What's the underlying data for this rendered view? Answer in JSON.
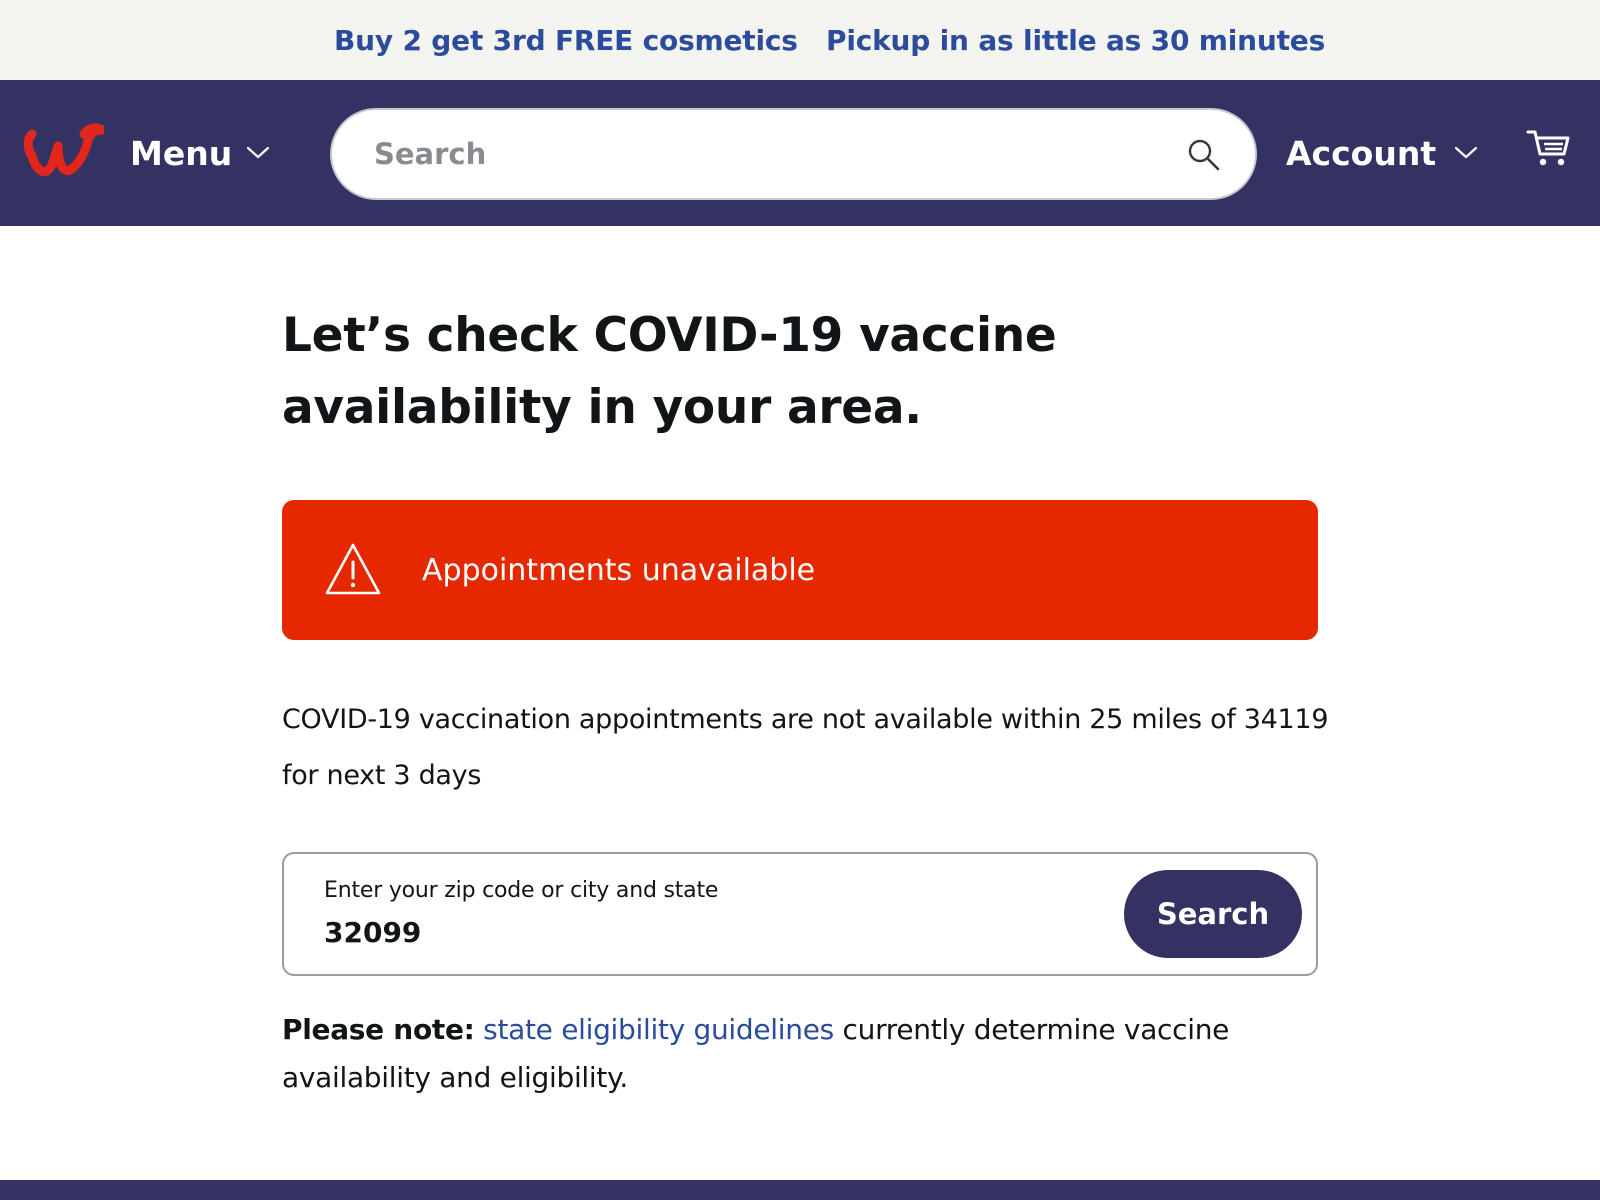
{
  "promo": {
    "left": "Buy 2 get 3rd FREE cosmetics",
    "right": "Pickup in as little as 30 minutes"
  },
  "nav": {
    "menu_label": "Menu",
    "search_placeholder": "Search",
    "account_label": "Account"
  },
  "main": {
    "title": "Let’s check COVID-19 vaccine availability in your area.",
    "alert_text": "Appointments unavailable",
    "message": "COVID-19 vaccination appointments are not available within 25 miles of 34119 for next 3 days",
    "zip_label": "Enter your zip code or city and state",
    "zip_value": "32099",
    "search_button": "Search",
    "note_bold": "Please note:",
    "note_link": "state eligibility guidelines",
    "note_rest": " currently determine vaccine availability and eligibility."
  },
  "colors": {
    "brand_navy": "#343263",
    "alert_red": "#e62800",
    "link_blue": "#2b4c9c",
    "logo_red": "#e1261c"
  },
  "icons": {
    "logo": "walgreens-w-logo",
    "menu_chevron": "chevron-down-icon",
    "search": "search-icon",
    "account_chevron": "chevron-down-icon",
    "cart": "cart-icon",
    "alert": "warning-triangle-icon"
  }
}
